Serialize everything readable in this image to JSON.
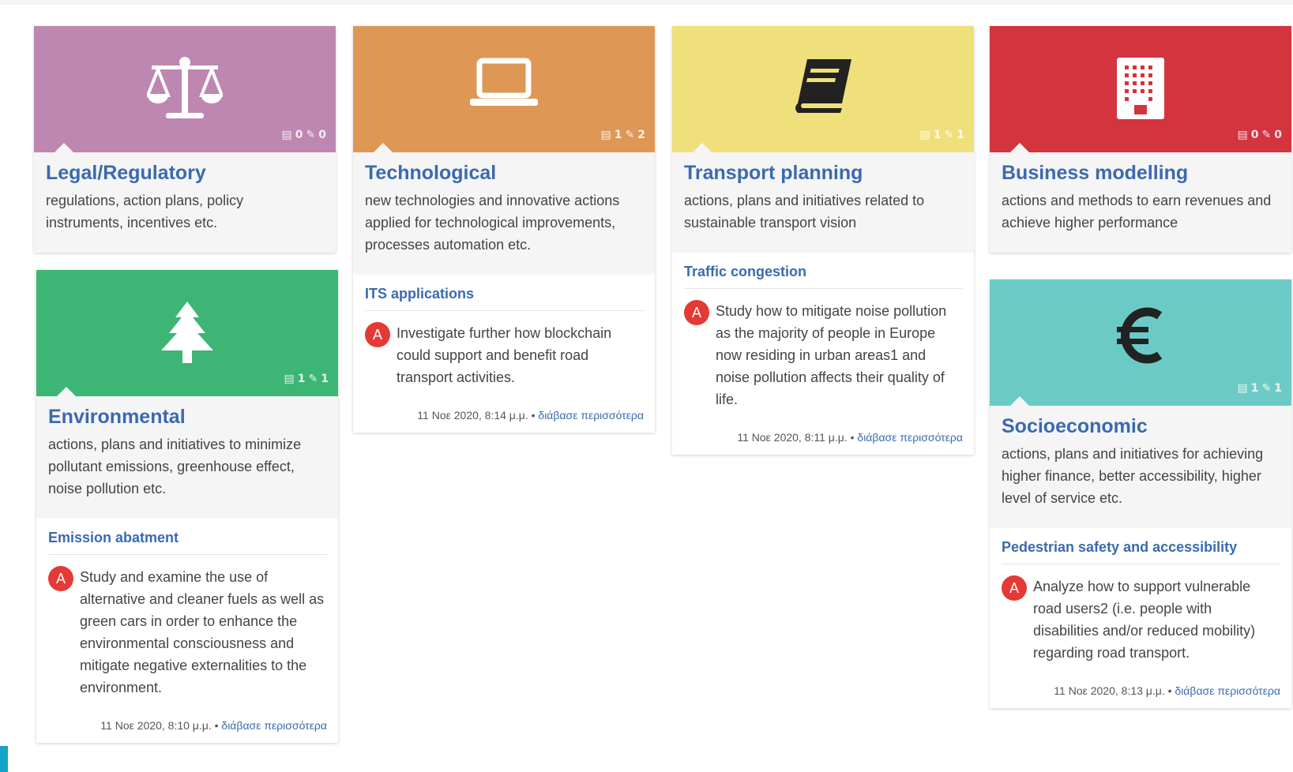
{
  "colors": {
    "legal": "#bd87b1",
    "tech": "#df9755",
    "transport": "#f0e07c",
    "business": "#d3343e",
    "environment": "#3db575",
    "socio": "#6ccac6",
    "link": "#3a6ab0",
    "avatar": "#e53935"
  },
  "cards": [
    {
      "key": "legal",
      "icon": "scales-icon",
      "title": "Legal/Regulatory",
      "desc": "regulations, action plans, policy instruments, incentives etc.",
      "docs": "0",
      "edits": "0"
    },
    {
      "key": "tech",
      "icon": "laptop-icon",
      "title": "Technological",
      "desc": "new technologies and innovative actions applied for technological improvements, processes automation etc.",
      "docs": "1",
      "edits": "2",
      "sub": "ITS applications",
      "avatar": "A",
      "post": "Investigate further how blockchain could support and benefit road transport activities.",
      "date": "11 Νοε 2020, 8:14 μ.μ.",
      "more": "διάβασε περισσότερα"
    },
    {
      "key": "transport",
      "icon": "book-icon",
      "title": "Transport planning",
      "desc": "actions, plans and initiatives related to sustainable transport vision",
      "docs": "1",
      "edits": "1",
      "sub": "Traffic congestion",
      "avatar": "A",
      "post": "Study how to mitigate noise pollution as the majority of people in Europe now residing in urban areas1 and noise pollution affects their quality of life.",
      "date": "11 Νοε 2020, 8:11 μ.μ.",
      "more": "διάβασε περισσότερα"
    },
    {
      "key": "business",
      "icon": "building-icon",
      "title": "Business modelling",
      "desc": "actions and methods to earn revenues and achieve higher performance",
      "docs": "0",
      "edits": "0"
    },
    {
      "key": "environment",
      "icon": "tree-icon",
      "title": "Environmental",
      "desc": "actions, plans and initiatives to minimize pollutant emissions, greenhouse effect, noise pollution etc.",
      "docs": "1",
      "edits": "1",
      "sub": "Emission abatment",
      "avatar": "A",
      "post": "Study and examine the use of alternative and cleaner fuels as well as green cars in order to enhance the environmental consciousness and mitigate negative externalities to the environment.",
      "date": "11 Νοε 2020, 8:10 μ.μ.",
      "more": "διάβασε περισσότερα"
    },
    {
      "key": "socio",
      "icon": "euro-icon",
      "title": "Socioeconomic",
      "desc": "actions, plans and initiatives for achieving higher finance, better accessibility, higher level of service etc.",
      "docs": "1",
      "edits": "1",
      "sub": "Pedestrian safety and accessibility",
      "avatar": "A",
      "post": "Analyze how to support vulnerable road users2 (i.e. people with disabilities and/or reduced mobility) regarding road transport.",
      "date": "11 Νοε 2020, 8:13 μ.μ.",
      "more": "διάβασε περισσότερα"
    }
  ]
}
